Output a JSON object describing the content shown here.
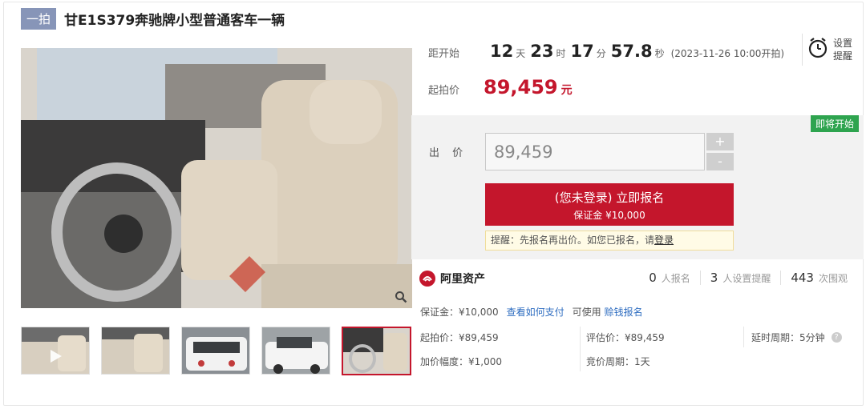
{
  "header": {
    "tag": "一拍",
    "title": "甘E1S379奔驰牌小型普通客车一辆"
  },
  "countdown": {
    "label": "距开始",
    "days": "12",
    "days_unit": "天",
    "hours": "23",
    "hours_unit": "时",
    "minutes": "17",
    "minutes_unit": "分",
    "seconds": "57.8",
    "seconds_unit": "秒",
    "start_text": "(2023-11-26 10:00开拍)"
  },
  "reminder": {
    "line1": "设置",
    "line2": "提醒",
    "icon": "alarm-clock-icon"
  },
  "starting_price": {
    "label": "起拍价",
    "value": "89,459",
    "unit": "元"
  },
  "bid": {
    "badge": "即将开始",
    "label": "出 价",
    "input_value": "89,459",
    "plus": "+",
    "minus": "-",
    "signup_line1": "(您未登录) 立即报名",
    "signup_line2": "保证金 ¥10,000",
    "tip_text": "提醒：先报名再出价。如您已报名，请",
    "tip_link": "登录"
  },
  "platform": {
    "name": "阿里资产",
    "stats": [
      {
        "num": "0",
        "text": "人报名"
      },
      {
        "num": "3",
        "text": "人设置提醒"
      },
      {
        "num": "443",
        "text": "次围观"
      }
    ]
  },
  "details": {
    "deposit": "保证金：¥10,000",
    "how_to_pay": "查看如何支付",
    "can_use": "可使用",
    "credit_signup": "赊钱报名",
    "start_price": "起拍价：¥89,459",
    "eval_price": "评估价：¥89,459",
    "delay_period": "延时周期：5分钟",
    "increment": "加价幅度：¥1,000",
    "bid_period": "竞价周期：1天"
  },
  "colors": {
    "brand_red": "#c4162c",
    "tag_bg": "#8795b8",
    "badge_green": "#2ea44f",
    "link_blue": "#2d6cc0"
  }
}
